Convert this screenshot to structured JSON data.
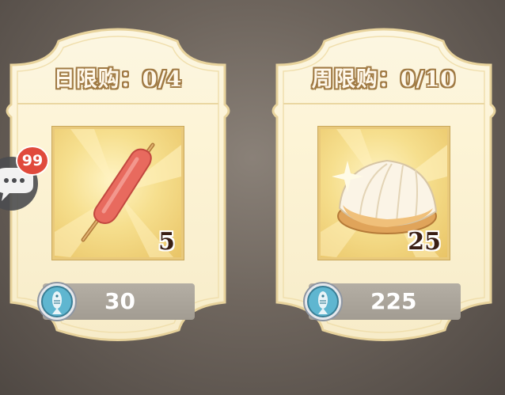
{
  "cards": [
    {
      "title": "日限购：0/4",
      "item_icon": "sausage-skewer-icon",
      "quantity": "5",
      "currency_icon": "fish-coin-icon",
      "price": "30"
    },
    {
      "title": "周限购：0/10",
      "item_icon": "shell-icon",
      "quantity": "25",
      "currency_icon": "fish-coin-icon",
      "price": "225"
    }
  ],
  "chat": {
    "icon": "chat-bubble-icon",
    "badge_count": "99"
  },
  "colors": {
    "card_bg": "#fbf3dc",
    "title_outline": "#a07a44",
    "slot_gold": "#f3d47f",
    "badge_red": "#e04a3c",
    "price_bar": "#aaa49a"
  }
}
